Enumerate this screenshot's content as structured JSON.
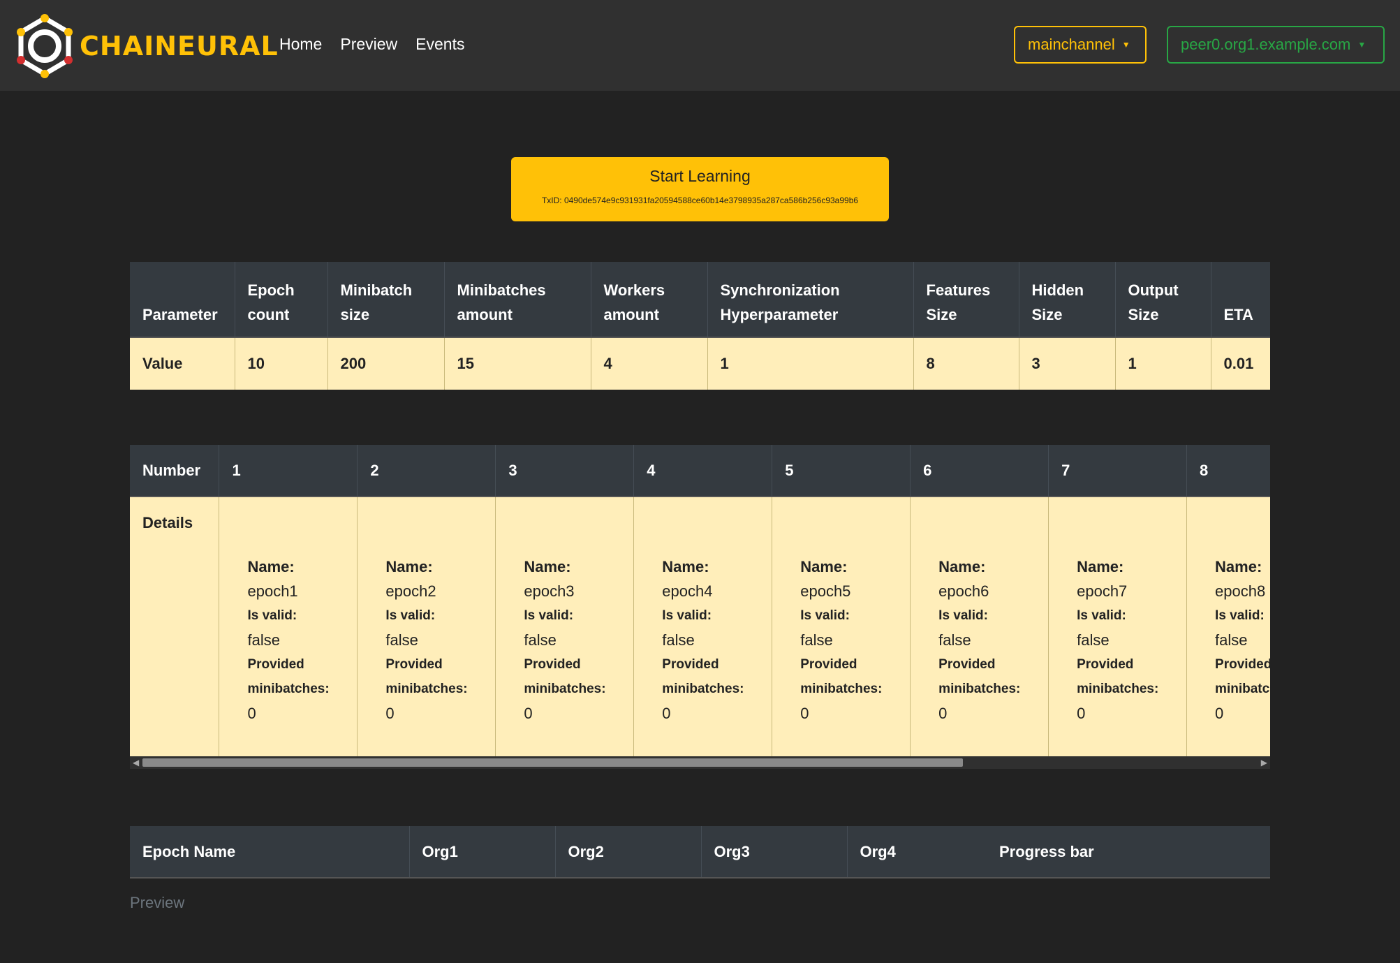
{
  "brand": {
    "name": "CHAINEURAL",
    "accent": "#ffc107"
  },
  "nav": {
    "links": [
      "Home",
      "Preview",
      "Events"
    ]
  },
  "channel_dropdown": {
    "label": "mainchannel"
  },
  "peer_dropdown": {
    "label": "peer0.org1.example.com"
  },
  "start": {
    "label": "Start Learning",
    "txid": "TxID: 0490de574e9c931931fa20594588ce60b14e3798935a287ca586b256c93a99b6"
  },
  "params": {
    "headers": [
      "Parameter",
      "Epoch count",
      "Minibatch size",
      "Minibatches amount",
      "Workers amount",
      "Synchronization Hyperparameter",
      "Features Size",
      "Hidden Size",
      "Output Size",
      "ETA"
    ],
    "values": [
      "Value",
      "10",
      "200",
      "15",
      "4",
      "1",
      "8",
      "3",
      "1",
      "0.01"
    ]
  },
  "epochs": {
    "number_label": "Number",
    "details_label": "Details",
    "name_key": "Name:",
    "valid_key": "Is valid:",
    "provided_key_1": "Provided",
    "provided_key_2": "minibatches:",
    "items": [
      {
        "number": "1",
        "name": "epoch1",
        "valid": "false",
        "provided": "0"
      },
      {
        "number": "2",
        "name": "epoch2",
        "valid": "false",
        "provided": "0"
      },
      {
        "number": "3",
        "name": "epoch3",
        "valid": "false",
        "provided": "0"
      },
      {
        "number": "4",
        "name": "epoch4",
        "valid": "false",
        "provided": "0"
      },
      {
        "number": "5",
        "name": "epoch5",
        "valid": "false",
        "provided": "0"
      },
      {
        "number": "6",
        "name": "epoch6",
        "valid": "false",
        "provided": "0"
      },
      {
        "number": "7",
        "name": "epoch7",
        "valid": "false",
        "provided": "0"
      },
      {
        "number": "8",
        "name": "epoch8",
        "valid": "false",
        "provided": "0"
      }
    ]
  },
  "progress_table": {
    "headers": [
      "Epoch Name",
      "Org1",
      "Org2",
      "Org3",
      "Org4",
      "Progress bar"
    ],
    "caption": "Preview"
  }
}
